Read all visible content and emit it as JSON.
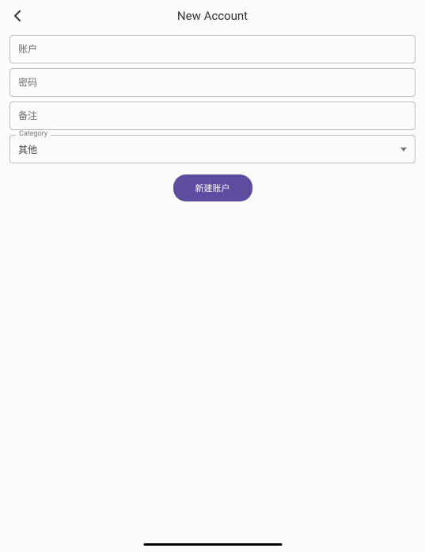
{
  "header": {
    "title": "New Account"
  },
  "form": {
    "account_placeholder": "账户",
    "password_placeholder": "密码",
    "note_placeholder": "备注",
    "category_label": "Category",
    "category_value": "其他",
    "submit_label": "新建账户"
  }
}
